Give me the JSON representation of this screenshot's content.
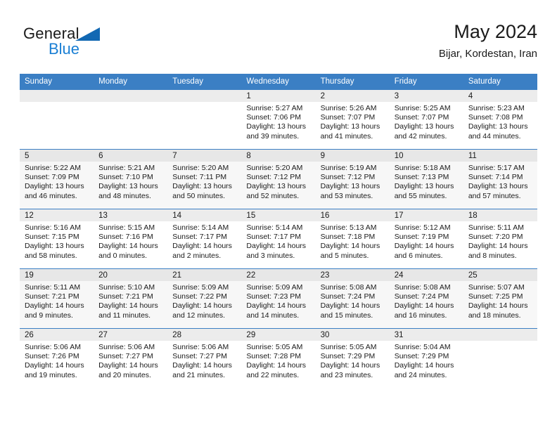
{
  "brand": {
    "line1": "General",
    "line2": "Blue",
    "triangle_color": "#1268b3",
    "blue_color": "#1a7fd4"
  },
  "header": {
    "title": "May 2024",
    "subtitle": "Bijar, Kordestan, Iran"
  },
  "theme": {
    "header_bg": "#3b7fc4",
    "header_text": "#ffffff",
    "daynum_band": "#ececec",
    "row_alt_bg": "#f7f7f7",
    "grid_line": "#3b7fc4"
  },
  "weekday_headers": [
    "Sunday",
    "Monday",
    "Tuesday",
    "Wednesday",
    "Thursday",
    "Friday",
    "Saturday"
  ],
  "weeks": [
    {
      "alt": false,
      "days": [
        {
          "day": "",
          "lines": []
        },
        {
          "day": "",
          "lines": []
        },
        {
          "day": "",
          "lines": []
        },
        {
          "day": "1",
          "lines": [
            "Sunrise: 5:27 AM",
            "Sunset: 7:06 PM",
            "Daylight: 13 hours",
            "and 39 minutes."
          ]
        },
        {
          "day": "2",
          "lines": [
            "Sunrise: 5:26 AM",
            "Sunset: 7:07 PM",
            "Daylight: 13 hours",
            "and 41 minutes."
          ]
        },
        {
          "day": "3",
          "lines": [
            "Sunrise: 5:25 AM",
            "Sunset: 7:07 PM",
            "Daylight: 13 hours",
            "and 42 minutes."
          ]
        },
        {
          "day": "4",
          "lines": [
            "Sunrise: 5:23 AM",
            "Sunset: 7:08 PM",
            "Daylight: 13 hours",
            "and 44 minutes."
          ]
        }
      ]
    },
    {
      "alt": true,
      "days": [
        {
          "day": "5",
          "lines": [
            "Sunrise: 5:22 AM",
            "Sunset: 7:09 PM",
            "Daylight: 13 hours",
            "and 46 minutes."
          ]
        },
        {
          "day": "6",
          "lines": [
            "Sunrise: 5:21 AM",
            "Sunset: 7:10 PM",
            "Daylight: 13 hours",
            "and 48 minutes."
          ]
        },
        {
          "day": "7",
          "lines": [
            "Sunrise: 5:20 AM",
            "Sunset: 7:11 PM",
            "Daylight: 13 hours",
            "and 50 minutes."
          ]
        },
        {
          "day": "8",
          "lines": [
            "Sunrise: 5:20 AM",
            "Sunset: 7:12 PM",
            "Daylight: 13 hours",
            "and 52 minutes."
          ]
        },
        {
          "day": "9",
          "lines": [
            "Sunrise: 5:19 AM",
            "Sunset: 7:12 PM",
            "Daylight: 13 hours",
            "and 53 minutes."
          ]
        },
        {
          "day": "10",
          "lines": [
            "Sunrise: 5:18 AM",
            "Sunset: 7:13 PM",
            "Daylight: 13 hours",
            "and 55 minutes."
          ]
        },
        {
          "day": "11",
          "lines": [
            "Sunrise: 5:17 AM",
            "Sunset: 7:14 PM",
            "Daylight: 13 hours",
            "and 57 minutes."
          ]
        }
      ]
    },
    {
      "alt": false,
      "days": [
        {
          "day": "12",
          "lines": [
            "Sunrise: 5:16 AM",
            "Sunset: 7:15 PM",
            "Daylight: 13 hours",
            "and 58 minutes."
          ]
        },
        {
          "day": "13",
          "lines": [
            "Sunrise: 5:15 AM",
            "Sunset: 7:16 PM",
            "Daylight: 14 hours",
            "and 0 minutes."
          ]
        },
        {
          "day": "14",
          "lines": [
            "Sunrise: 5:14 AM",
            "Sunset: 7:17 PM",
            "Daylight: 14 hours",
            "and 2 minutes."
          ]
        },
        {
          "day": "15",
          "lines": [
            "Sunrise: 5:14 AM",
            "Sunset: 7:17 PM",
            "Daylight: 14 hours",
            "and 3 minutes."
          ]
        },
        {
          "day": "16",
          "lines": [
            "Sunrise: 5:13 AM",
            "Sunset: 7:18 PM",
            "Daylight: 14 hours",
            "and 5 minutes."
          ]
        },
        {
          "day": "17",
          "lines": [
            "Sunrise: 5:12 AM",
            "Sunset: 7:19 PM",
            "Daylight: 14 hours",
            "and 6 minutes."
          ]
        },
        {
          "day": "18",
          "lines": [
            "Sunrise: 5:11 AM",
            "Sunset: 7:20 PM",
            "Daylight: 14 hours",
            "and 8 minutes."
          ]
        }
      ]
    },
    {
      "alt": true,
      "days": [
        {
          "day": "19",
          "lines": [
            "Sunrise: 5:11 AM",
            "Sunset: 7:21 PM",
            "Daylight: 14 hours",
            "and 9 minutes."
          ]
        },
        {
          "day": "20",
          "lines": [
            "Sunrise: 5:10 AM",
            "Sunset: 7:21 PM",
            "Daylight: 14 hours",
            "and 11 minutes."
          ]
        },
        {
          "day": "21",
          "lines": [
            "Sunrise: 5:09 AM",
            "Sunset: 7:22 PM",
            "Daylight: 14 hours",
            "and 12 minutes."
          ]
        },
        {
          "day": "22",
          "lines": [
            "Sunrise: 5:09 AM",
            "Sunset: 7:23 PM",
            "Daylight: 14 hours",
            "and 14 minutes."
          ]
        },
        {
          "day": "23",
          "lines": [
            "Sunrise: 5:08 AM",
            "Sunset: 7:24 PM",
            "Daylight: 14 hours",
            "and 15 minutes."
          ]
        },
        {
          "day": "24",
          "lines": [
            "Sunrise: 5:08 AM",
            "Sunset: 7:24 PM",
            "Daylight: 14 hours",
            "and 16 minutes."
          ]
        },
        {
          "day": "25",
          "lines": [
            "Sunrise: 5:07 AM",
            "Sunset: 7:25 PM",
            "Daylight: 14 hours",
            "and 18 minutes."
          ]
        }
      ]
    },
    {
      "alt": false,
      "days": [
        {
          "day": "26",
          "lines": [
            "Sunrise: 5:06 AM",
            "Sunset: 7:26 PM",
            "Daylight: 14 hours",
            "and 19 minutes."
          ]
        },
        {
          "day": "27",
          "lines": [
            "Sunrise: 5:06 AM",
            "Sunset: 7:27 PM",
            "Daylight: 14 hours",
            "and 20 minutes."
          ]
        },
        {
          "day": "28",
          "lines": [
            "Sunrise: 5:06 AM",
            "Sunset: 7:27 PM",
            "Daylight: 14 hours",
            "and 21 minutes."
          ]
        },
        {
          "day": "29",
          "lines": [
            "Sunrise: 5:05 AM",
            "Sunset: 7:28 PM",
            "Daylight: 14 hours",
            "and 22 minutes."
          ]
        },
        {
          "day": "30",
          "lines": [
            "Sunrise: 5:05 AM",
            "Sunset: 7:29 PM",
            "Daylight: 14 hours",
            "and 23 minutes."
          ]
        },
        {
          "day": "31",
          "lines": [
            "Sunrise: 5:04 AM",
            "Sunset: 7:29 PM",
            "Daylight: 14 hours",
            "and 24 minutes."
          ]
        },
        {
          "day": "",
          "lines": []
        }
      ]
    }
  ]
}
